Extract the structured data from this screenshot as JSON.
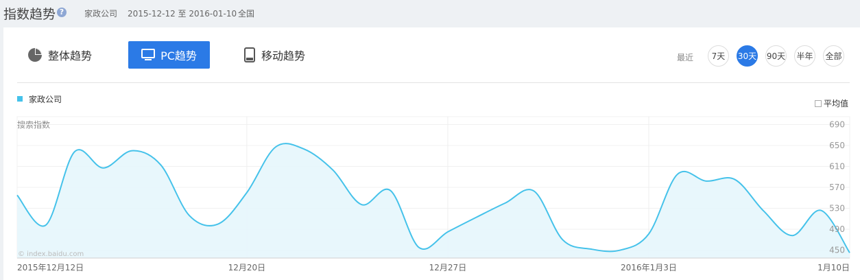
{
  "header": {
    "title": "指数趋势",
    "help": "?",
    "keyword": "家政公司",
    "date_range": "2015-12-12 至 2016-01-10",
    "region": "全国"
  },
  "tabs": [
    {
      "label": "整体趋势",
      "icon": "pie-chart-icon"
    },
    {
      "label": "PC趋势",
      "icon": "monitor-icon"
    },
    {
      "label": "移动趋势",
      "icon": "mobile-icon"
    }
  ],
  "range": {
    "label": "最近",
    "options": [
      "7天",
      "30天",
      "90天",
      "半年",
      "全部"
    ],
    "active": "30天"
  },
  "legend": {
    "series": "家政公司",
    "average_label": "平均值"
  },
  "watermark": "© index.baidu.com",
  "colors": {
    "accent": "#2b7ae6",
    "series": "#45c2ea",
    "fill": "#e6f6fc"
  },
  "chart_data": {
    "type": "area",
    "ylabel": "搜索指数",
    "yticks": [
      690,
      650,
      610,
      570,
      530,
      490,
      450
    ],
    "ylim": [
      435,
      705
    ],
    "x": [
      "2015-12-12",
      "2015-12-13",
      "2015-12-14",
      "2015-12-15",
      "2015-12-16",
      "2015-12-17",
      "2015-12-18",
      "2015-12-19",
      "2015-12-20",
      "2015-12-21",
      "2015-12-22",
      "2015-12-23",
      "2015-12-24",
      "2015-12-25",
      "2015-12-26",
      "2015-12-27",
      "2015-12-28",
      "2015-12-29",
      "2015-12-30",
      "2015-12-31",
      "2016-01-01",
      "2016-01-02",
      "2016-01-03",
      "2016-01-04",
      "2016-01-05",
      "2016-01-06",
      "2016-01-07",
      "2016-01-08",
      "2016-01-09",
      "2016-01-10"
    ],
    "xtick_labels": [
      {
        "index": 0,
        "label": "2015年12月12日"
      },
      {
        "index": 8,
        "label": "12月20日"
      },
      {
        "index": 15,
        "label": "12月27日"
      },
      {
        "index": 22,
        "label": "2016年1月3日"
      },
      {
        "index": 29,
        "label": "1月10日"
      }
    ],
    "series": [
      {
        "name": "家政公司",
        "values": [
          555,
          498,
          638,
          607,
          640,
          613,
          516,
          500,
          560,
          647,
          643,
          603,
          537,
          564,
          455,
          485,
          513,
          540,
          563,
          470,
          452,
          450,
          481,
          595,
          582,
          585,
          525,
          478,
          526,
          445
        ]
      }
    ]
  }
}
